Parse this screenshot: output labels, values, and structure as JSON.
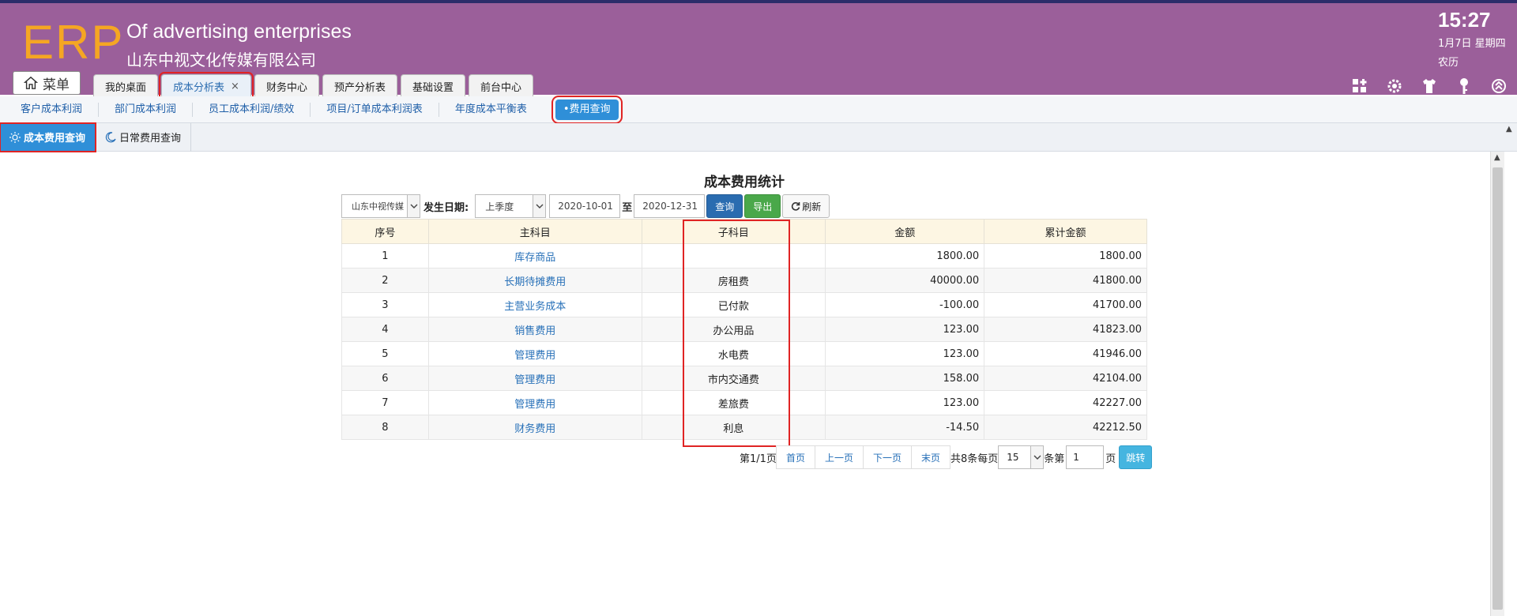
{
  "header": {
    "logo": "ERP",
    "brand_en": "Of advertising enterprises",
    "brand_cn": "山东中视文化传媒有限公司",
    "time": "15:27",
    "date": "1月7日 星期四",
    "lunar": "农历",
    "menu_label": "菜单",
    "tabs": [
      {
        "label": "我的桌面"
      },
      {
        "label": "成本分析表",
        "close": "×"
      },
      {
        "label": "财务中心"
      },
      {
        "label": "预产分析表"
      },
      {
        "label": "基础设置"
      },
      {
        "label": "前台中心"
      }
    ],
    "icons": [
      "grid-add-icon",
      "gear-icon",
      "shirt-icon",
      "key-icon",
      "collapse-icon"
    ]
  },
  "subnav": {
    "items": [
      "客户成本利润",
      "部门成本利润",
      "员工成本利润/绩效",
      "项目/订单成本利润表",
      "年度成本平衡表"
    ],
    "active": "•费用查询"
  },
  "subtabs": {
    "active": "成本费用查询",
    "other": "日常费用查询"
  },
  "main": {
    "title": "成本费用统计",
    "company_select": "山东中视传媒",
    "date_label": "发生日期:",
    "period_select": "上季度",
    "date_from": "2020-10-01",
    "to_label": "至",
    "date_to": "2020-12-31",
    "query_btn": "查询",
    "export_btn": "导出",
    "refresh_btn": "刷新"
  },
  "table": {
    "headers": [
      "序号",
      "主科目",
      "子科目",
      "金额",
      "累计金额"
    ],
    "rows": [
      {
        "no": "1",
        "main": "库存商品",
        "sub": "",
        "amount": "1800.00",
        "total": "1800.00"
      },
      {
        "no": "2",
        "main": "长期待摊费用",
        "sub": "房租费",
        "amount": "40000.00",
        "total": "41800.00"
      },
      {
        "no": "3",
        "main": "主营业务成本",
        "sub": "已付款",
        "amount": "-100.00",
        "total": "41700.00"
      },
      {
        "no": "4",
        "main": "销售费用",
        "sub": "办公用品",
        "amount": "123.00",
        "total": "41823.00"
      },
      {
        "no": "5",
        "main": "管理费用",
        "sub": "水电费",
        "amount": "123.00",
        "total": "41946.00"
      },
      {
        "no": "6",
        "main": "管理费用",
        "sub": "市内交通费",
        "amount": "158.00",
        "total": "42104.00"
      },
      {
        "no": "7",
        "main": "管理费用",
        "sub": "差旅费",
        "amount": "123.00",
        "total": "42227.00"
      },
      {
        "no": "8",
        "main": "财务费用",
        "sub": "利息",
        "amount": "-14.50",
        "total": "42212.50"
      }
    ]
  },
  "pager": {
    "page_info": "第1/1页",
    "first": "首页",
    "prev": "上一页",
    "next": "下一页",
    "last": "末页",
    "total_info": "共8条每页",
    "page_size": "15",
    "jump_prefix": "条第",
    "jump_value": "1",
    "jump_suffix": "页",
    "go": "跳转"
  }
}
